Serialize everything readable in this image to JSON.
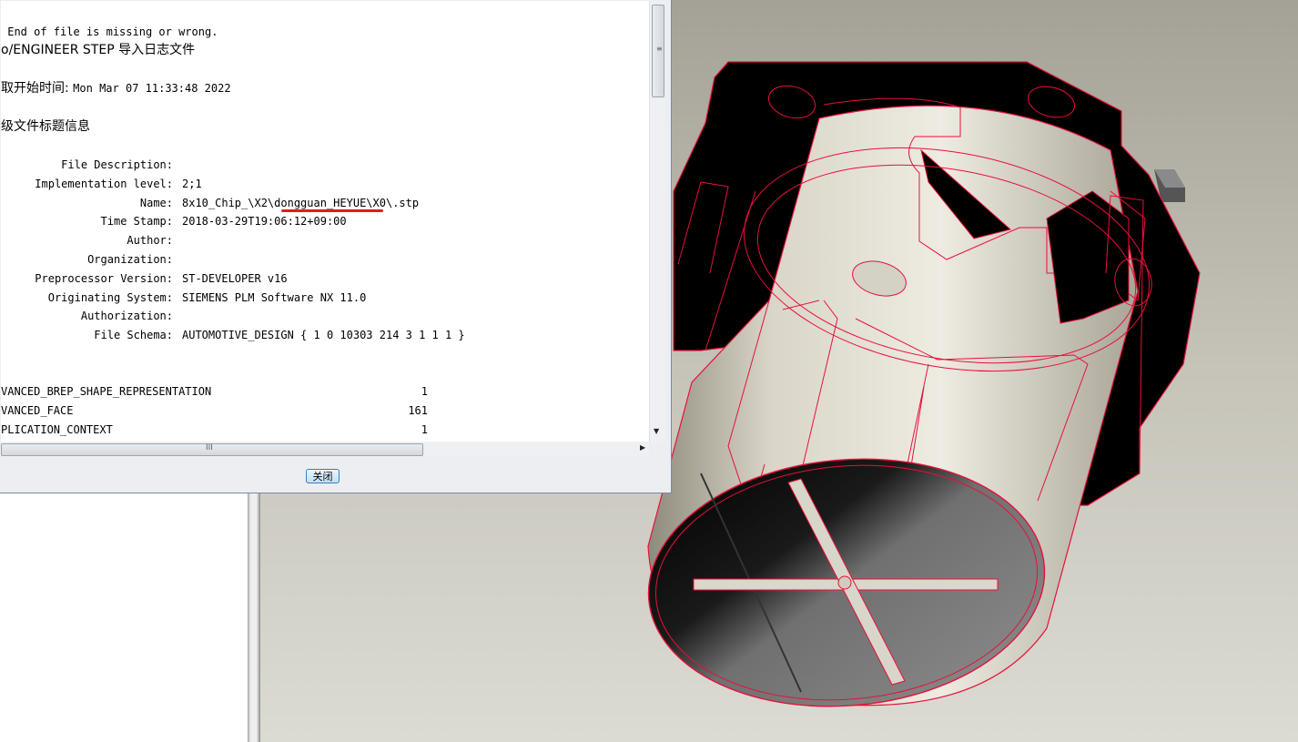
{
  "log": {
    "line_eof": " End of file is missing or wrong.",
    "line_title": "o/ENGINEER STEP 导入日志文件",
    "line_start_label": "取开始时间: ",
    "line_start_value": "Mon Mar 07 11:33:48 2022",
    "line_header": "级文件标题信息",
    "header_fields": [
      {
        "label": "File Description:",
        "value": ""
      },
      {
        "label": "Implementation level:",
        "value": "2;1"
      },
      {
        "label": "Name:",
        "value": "8x10_Chip_\\X2\\dongguan_HEYUE\\X0\\.stp"
      },
      {
        "label": "Time Stamp:",
        "value": "2018-03-29T19:06:12+09:00"
      },
      {
        "label": "Author:",
        "value": ""
      },
      {
        "label": "Organization:",
        "value": ""
      },
      {
        "label": "Preprocessor Version:",
        "value": "ST-DEVELOPER v16"
      },
      {
        "label": "Originating System:",
        "value": "SIEMENS PLM Software NX 11.0"
      },
      {
        "label": "Authorization:",
        "value": ""
      },
      {
        "label": "File Schema:",
        "value": "AUTOMOTIVE_DESIGN { 1 0 10303 214 3 1 1 1 }"
      }
    ],
    "entities": [
      {
        "name": "VANCED_BREP_SHAPE_REPRESENTATION",
        "count": "1"
      },
      {
        "name": "VANCED_FACE",
        "count": "161"
      },
      {
        "name": "PLICATION_CONTEXT",
        "count": "1"
      }
    ]
  },
  "dialog": {
    "close_label": "关闭",
    "vgrip": "≡",
    "hgrip": "III",
    "down_arrow": "▼",
    "right_arrow": "▶"
  },
  "colors": {
    "edge_highlight": "#e8103a",
    "viewport_bg": "#c9c7bb",
    "model_body": "#dedbd0"
  }
}
